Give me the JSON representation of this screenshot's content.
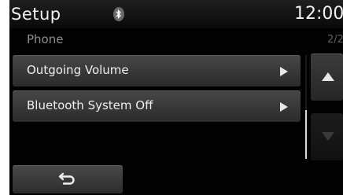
{
  "header": {
    "title": "Setup",
    "bluetooth_icon": "bluetooth-icon",
    "clock": "12:00"
  },
  "subheader": {
    "title": "Phone",
    "page_indicator": "2/2"
  },
  "menu": {
    "items": [
      {
        "label": "Outgoing Volume",
        "icon": "chevron-right-icon"
      },
      {
        "label": "Bluetooth System Off",
        "icon": "chevron-right-icon"
      }
    ]
  },
  "scroll": {
    "up_icon": "up-arrow-icon",
    "down_icon": "down-arrow-icon",
    "up_enabled": true,
    "down_enabled": false
  },
  "footer": {
    "back_icon": "back-arrow-icon"
  },
  "colors": {
    "background": "#020202",
    "button_top": "#474747",
    "button_bottom": "#2b2b2b",
    "text": "#eeeeee",
    "subtext": "#8e8e8e"
  }
}
